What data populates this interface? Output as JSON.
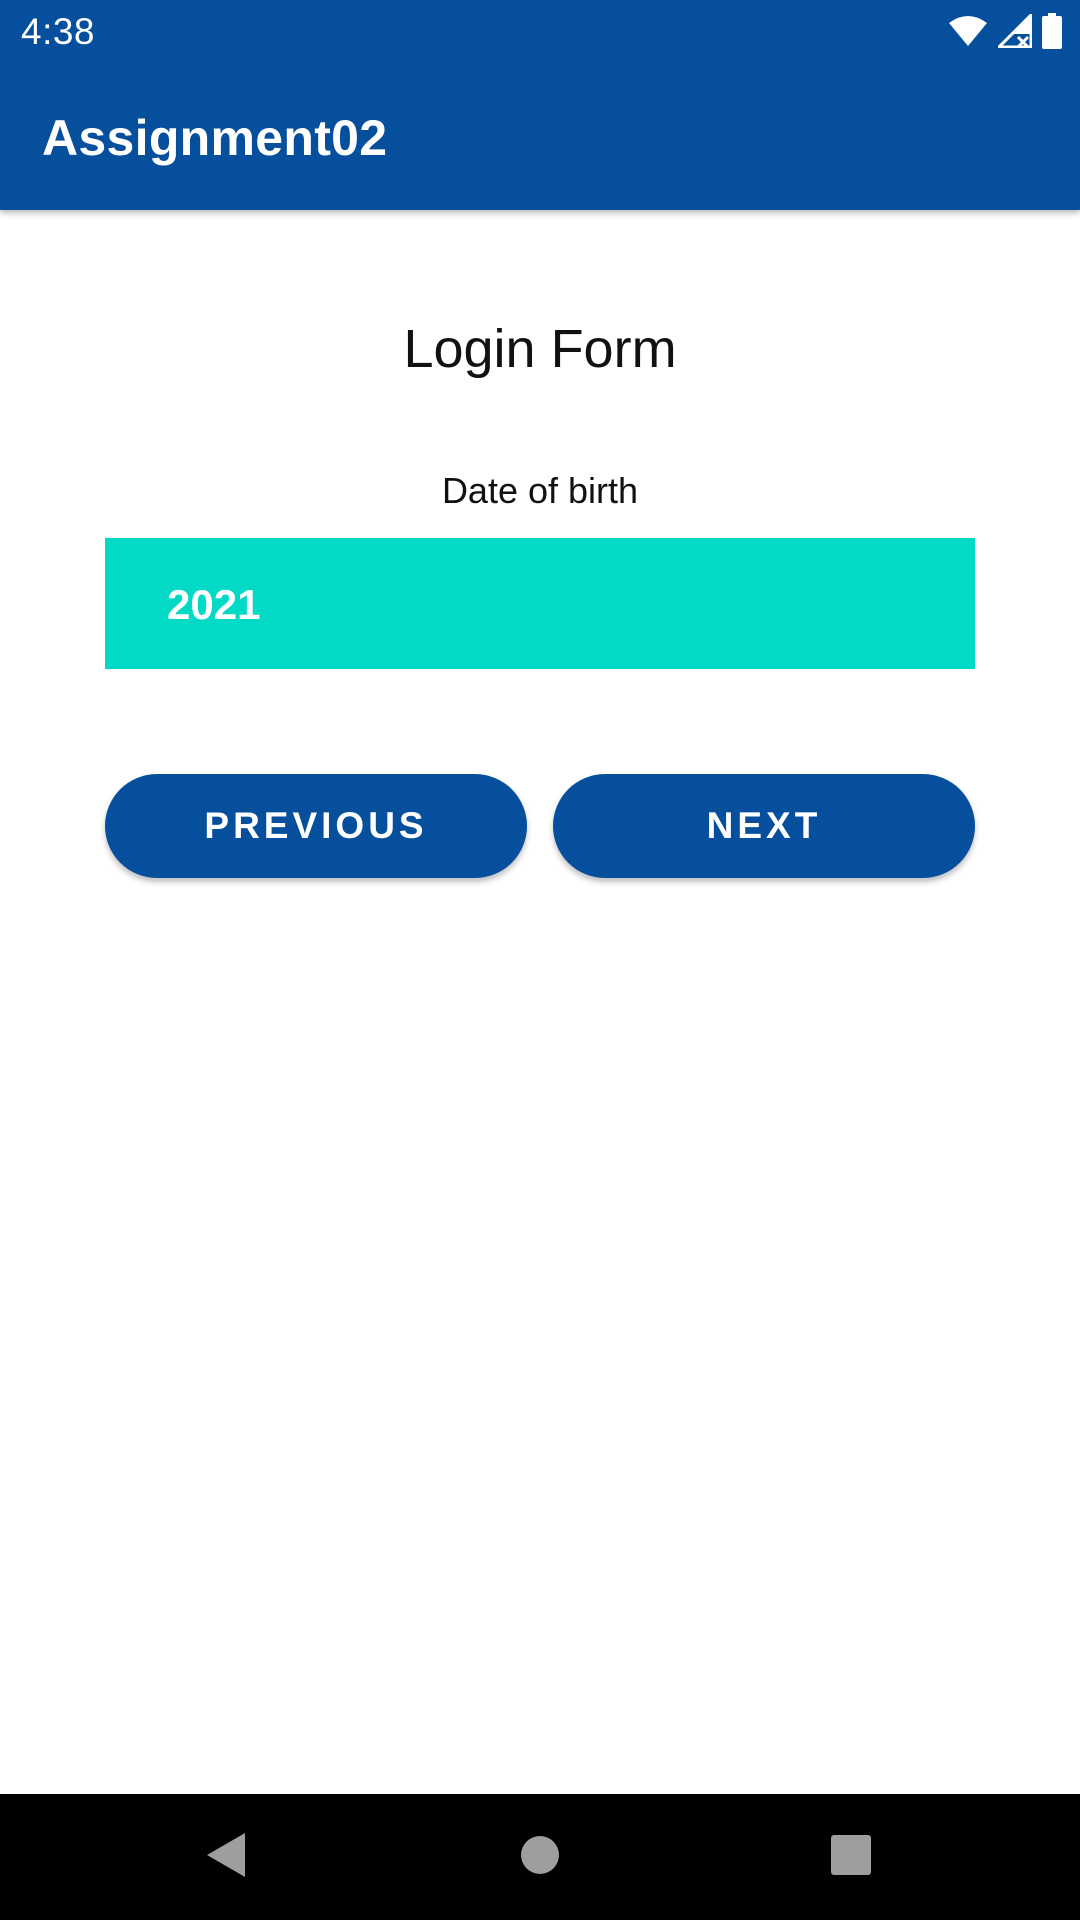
{
  "status_bar": {
    "time": "4:38",
    "icons": [
      "wifi-icon",
      "cell-signal-icon",
      "battery-icon"
    ]
  },
  "app_bar": {
    "title": "Assignment02"
  },
  "form": {
    "title": "Login Form",
    "dob_label": "Date of birth",
    "year_value": "2021"
  },
  "buttons": {
    "previous": "PREVIOUS",
    "next": "NEXT"
  },
  "nav_bar": {
    "icons": [
      "back-icon",
      "home-icon",
      "recents-icon"
    ]
  },
  "colors": {
    "primary": "#054f9d",
    "accent": "#03dac6",
    "nav_background": "#000000"
  }
}
